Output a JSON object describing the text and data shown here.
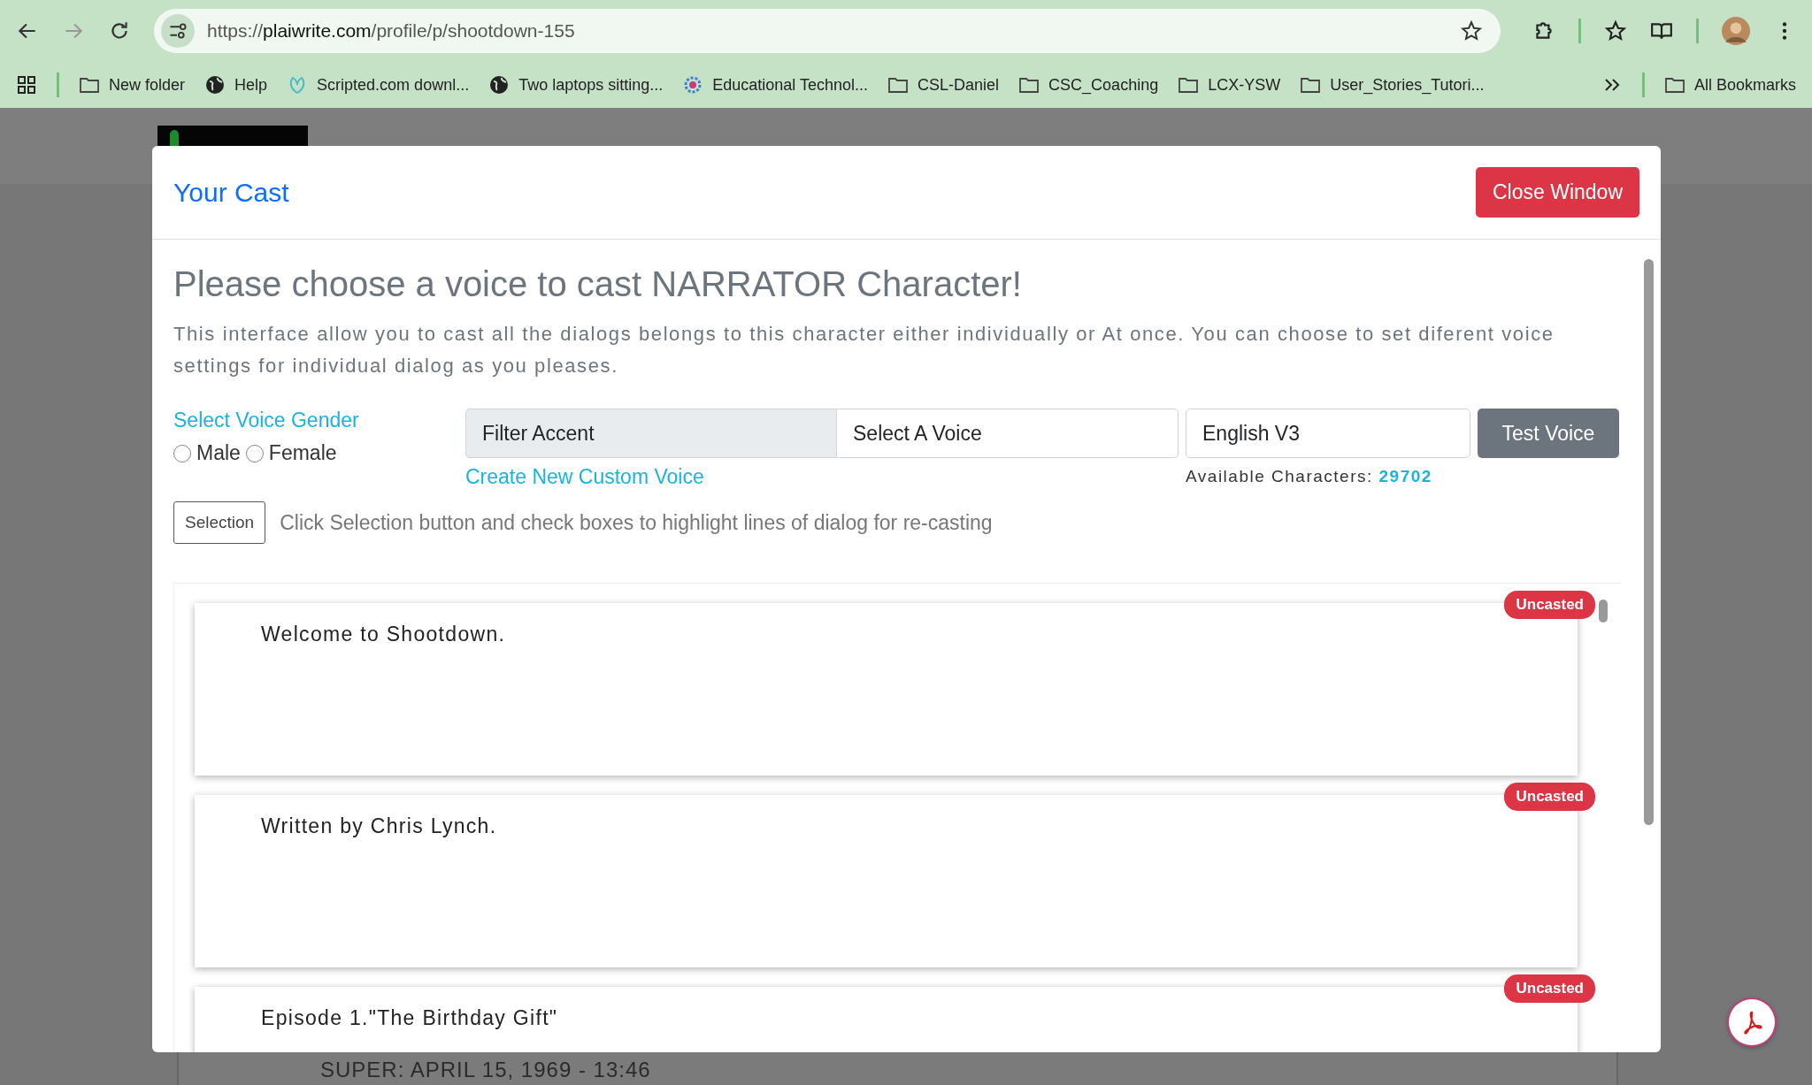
{
  "browser": {
    "url_scheme": "https://",
    "url_host": "plaiwrite.com",
    "url_path": "/profile/p/shootdown-155"
  },
  "bookmarks": [
    {
      "label": "New folder",
      "kind": "folder"
    },
    {
      "label": "Help",
      "kind": "globe"
    },
    {
      "label": "Scripted.com downl...",
      "kind": "app"
    },
    {
      "label": "Two laptops sitting...",
      "kind": "globe"
    },
    {
      "label": "Educational Technol...",
      "kind": "gear"
    },
    {
      "label": "CSL-Daniel",
      "kind": "folder"
    },
    {
      "label": "CSC_Coaching",
      "kind": "folder"
    },
    {
      "label": "LCX-YSW",
      "kind": "folder"
    },
    {
      "label": "User_Stories_Tutori...",
      "kind": "folder"
    }
  ],
  "all_bookmarks": "All Bookmarks",
  "site": {
    "script_line": "SUPER: APRIL 15, 1969 - 13:46"
  },
  "modal": {
    "title": "Your Cast",
    "close_button": "Close Window",
    "heading": "Please choose a voice to cast NARRATOR Character!",
    "description": "This interface allow you to cast all the dialogs belongs to this character either individually or At once. You can choose to set diferent voice settings for individual dialog as you pleases.",
    "gender": {
      "label": "Select Voice Gender",
      "options": [
        {
          "label": "Male",
          "selected": false
        },
        {
          "label": "Female",
          "selected": false
        }
      ]
    },
    "accent_filter": {
      "placeholder": "Filter Accent"
    },
    "voice_select": {
      "value": "Select A Voice"
    },
    "model_field": {
      "value": "English V3"
    },
    "test_button": "Test Voice",
    "custom_voice_link": "Create New Custom Voice",
    "available_label": "Available Characters:",
    "available_count": "29702",
    "selection_button": "Selection",
    "selection_hint": "Click Selection button and check boxes to highlight lines of dialog for re-casting",
    "dialogs": [
      {
        "text": "Welcome to Shootdown.",
        "status": "Uncasted"
      },
      {
        "text": "Written by Chris Lynch.",
        "status": "Uncasted"
      },
      {
        "text": "Episode 1.\"The Birthday Gift\"",
        "status": "Uncasted"
      }
    ]
  }
}
